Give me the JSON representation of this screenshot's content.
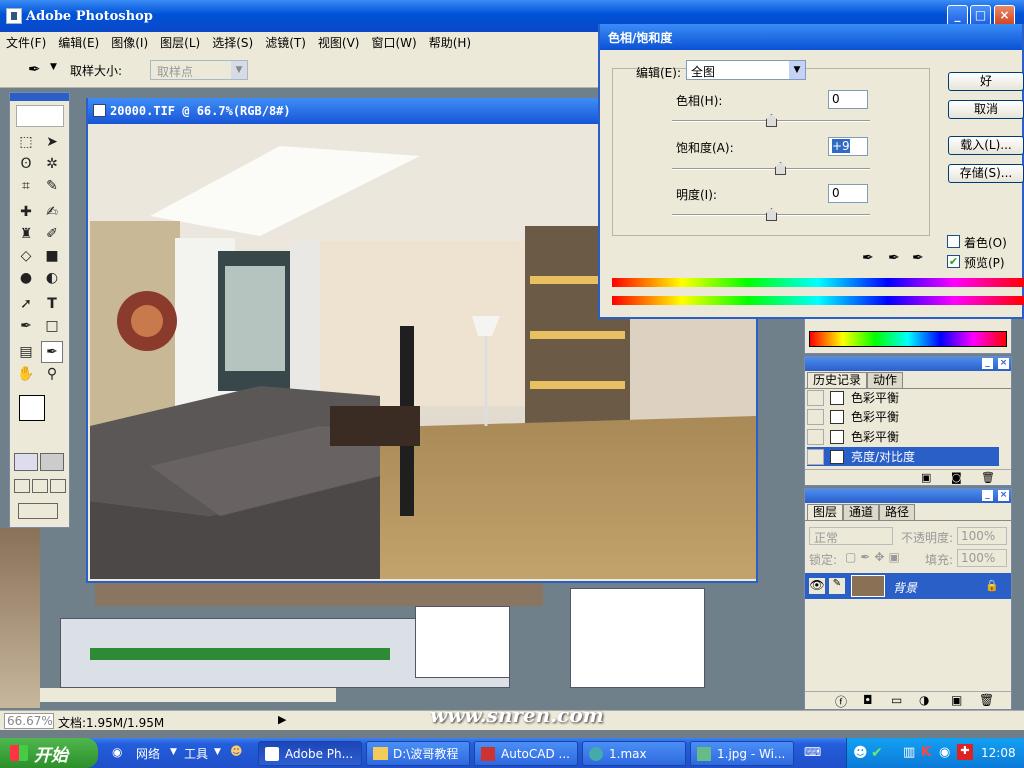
{
  "app": {
    "title": "Adobe Photoshop"
  },
  "menu": [
    "文件(F)",
    "编辑(E)",
    "图像(I)",
    "图层(L)",
    "选择(S)",
    "滤镜(T)",
    "视图(V)",
    "窗口(W)",
    "帮助(H)"
  ],
  "options": {
    "sample_size_label": "取样大小:",
    "sample_size_value": "取样点"
  },
  "document": {
    "title": "20000.TIF @ 66.7%(RGB/8#)"
  },
  "dialog": {
    "title": "色相/饱和度",
    "edit_label": "编辑(E):",
    "edit_value": "全图",
    "hue_label": "色相(H):",
    "hue_value": "0",
    "sat_label": "饱和度(A):",
    "sat_value": "+9",
    "light_label": "明度(I):",
    "light_value": "0",
    "ok": "好",
    "cancel": "取消",
    "load": "载入(L)...",
    "save": "存储(S)...",
    "colorize_label": "着色(O)",
    "colorize_checked": false,
    "preview_label": "预览(P)",
    "preview_checked": true
  },
  "history": {
    "tabs": [
      "历史记录",
      "动作"
    ],
    "items": [
      "色彩平衡",
      "色彩平衡",
      "色彩平衡",
      "亮度/对比度"
    ]
  },
  "layers": {
    "tabs": [
      "图层",
      "通道",
      "路径"
    ],
    "blend_mode": "正常",
    "opacity_label": "不透明度:",
    "opacity_value": "100%",
    "lock_label": "锁定:",
    "fill_label": "填充:",
    "fill_value": "100%",
    "layer_name": "背景"
  },
  "status": {
    "zoom": "66.67%",
    "doc_size": "文档:1.95M/1.95M"
  },
  "watermark": "www.snren.com",
  "taskbar": {
    "start": "开始",
    "quick": [
      "网络",
      "工具"
    ],
    "tasks": [
      "Adobe Ph...",
      "D:\\波哥教程",
      "AutoCAD ...",
      "1.max",
      "1.jpg - Wi..."
    ],
    "clock": "12:08"
  },
  "colors": {
    "xp_blue": "#2b5fc8",
    "selection": "#2b5fc8"
  }
}
